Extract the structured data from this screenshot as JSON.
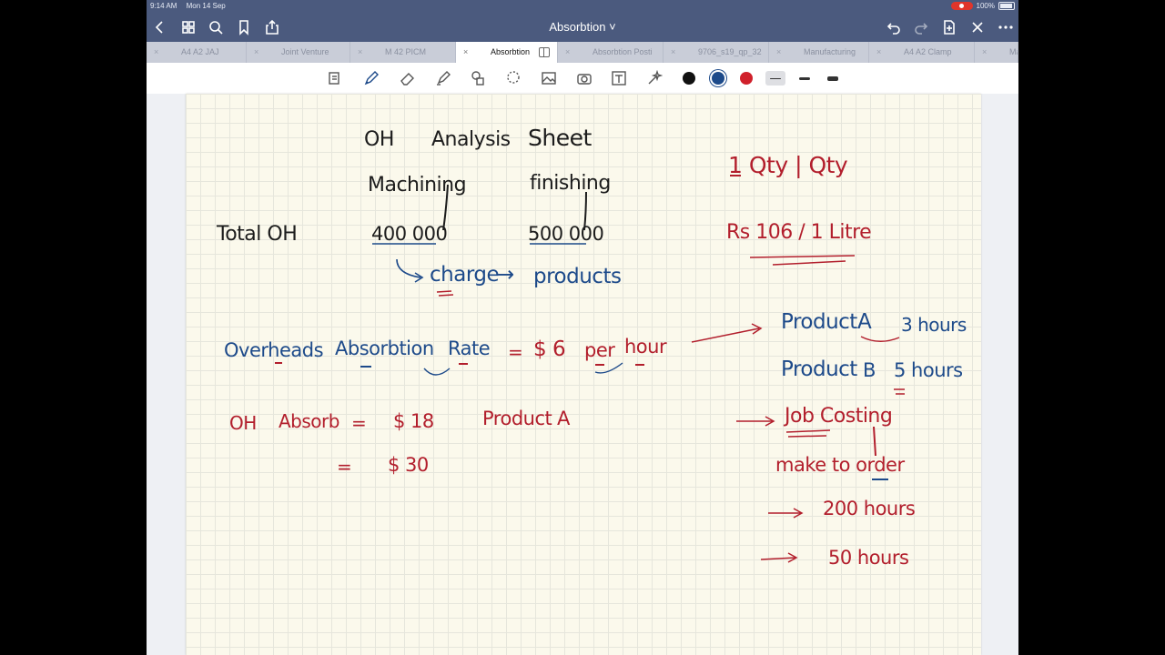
{
  "status": {
    "time": "9:14 AM",
    "date": "Mon 14 Sep",
    "battery": "100%"
  },
  "document": {
    "title": "Absorbtion ˅"
  },
  "tabs": [
    {
      "label": "A4 A2 JAJ",
      "active": false
    },
    {
      "label": "Joint Venture",
      "active": false
    },
    {
      "label": "M 42 PICM",
      "active": false
    },
    {
      "label": "Absorbtion",
      "active": true
    },
    {
      "label": "Absorbtion Posti",
      "active": false
    },
    {
      "label": "9706_s19_qp_32",
      "active": false
    },
    {
      "label": "Manufacturing",
      "active": false
    },
    {
      "label": "A4 A2 Clamp",
      "active": false
    },
    {
      "label": "Manuf",
      "active": false
    }
  ],
  "toolbar": {
    "tools": [
      "reader-icon",
      "pen-icon",
      "eraser-icon",
      "highlighter-icon",
      "shapes-icon",
      "lasso-icon",
      "image-icon",
      "camera-icon",
      "text-icon",
      "laser-icon"
    ],
    "colors": [
      "#111111",
      "#1d4a8a",
      "#d0202b"
    ]
  },
  "notes": {
    "title_oh": "OH",
    "title_analysis": "Analysis",
    "title_sheet": "Sheet",
    "col_machining": "Machining",
    "col_finishing": "finishing",
    "row_total": "Total OH",
    "val_machining": "400 000",
    "val_finishing": "500 000",
    "charge": "charge",
    "arrow_to": "→",
    "products": "products",
    "oar_overheads": "Overheads",
    "oar_absorbtion": "Absorbtion",
    "oar_rate": "Rate",
    "oar_eq": "=",
    "oar_value": "$ 6",
    "oar_per": "per",
    "oar_hour": "hour",
    "oh_absorb": "OH",
    "oh_absorb2": "Absorb",
    "eq1": "=",
    "val18": "$ 18",
    "product_a_label": "Product",
    "product_a_letter": "A",
    "eq2": "=",
    "val30": "$ 30",
    "ratio1": "1 Qty  |  Qty",
    "ratio2": "Rs 106 / 1 Litre",
    "prodA_word": "Product",
    "prodA_letter": "A",
    "prodA_hours": "3 hours",
    "prodB_word": "Product",
    "prodB_letter": "B",
    "prodB_hours": "5 hours",
    "job_costing": "Job Costing",
    "make_to_order": "make to order",
    "h200": "200 hours",
    "h50": "50 hours"
  }
}
